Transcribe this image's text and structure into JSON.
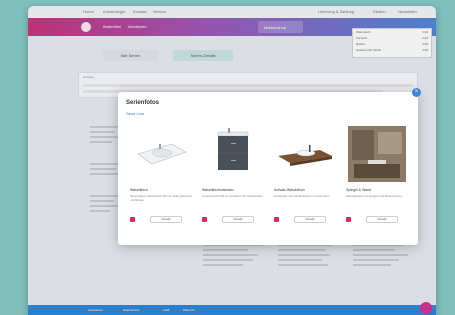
{
  "topbar": {
    "links": [
      "Home",
      "Kundenlogin",
      "Kontakt",
      "Service"
    ],
    "right_links": [
      "Lieferung & Zahlung",
      "Filialen",
      "Newsletter"
    ]
  },
  "brandbar": {
    "nav": [
      "Badmöbel",
      "Armaturen"
    ],
    "highlight": "Markenshop"
  },
  "cart": {
    "rows": [
      [
        "Warenkorb",
        "0,00"
      ],
      [
        "Versand",
        "0,00"
      ],
      [
        "Rabatt",
        "0,00"
      ],
      [
        "Gesamt inkl. MwSt",
        "0,00"
      ]
    ]
  },
  "tabs": [
    "Alle Serien",
    "Serien-Details"
  ],
  "info": {
    "title": "Hinweis"
  },
  "modal": {
    "title": "Serienfotos",
    "subtitle": "Serie Lisa",
    "close": "×",
    "cards": [
      {
        "name": "Waschtisch",
        "desc": "Mineralguss Waschtisch 80 cm weiß glänzend mit Ablage",
        "button": "Details"
      },
      {
        "name": "Waschtischunterbau",
        "desc": "Unterschrank 80 cm anthrazit mit Schubladen",
        "button": "Details"
      },
      {
        "name": "Aufsatz-Waschtisch",
        "desc": "Holzplatte mit Aufsatzbecken und Armatur",
        "button": "Details"
      },
      {
        "name": "Spiegel & Wand",
        "desc": "Wandpaneel mit Spiegel und Beleuchtung",
        "button": "Details"
      }
    ]
  },
  "footer": {
    "links": [
      "Impressum",
      "Datenschutz",
      "AGB",
      "Widerruf"
    ]
  },
  "colors": {
    "brand_start": "#c9307a",
    "brand_end": "#4f86d9",
    "accent": "#2d7ec9",
    "fav": "#e02a63"
  }
}
